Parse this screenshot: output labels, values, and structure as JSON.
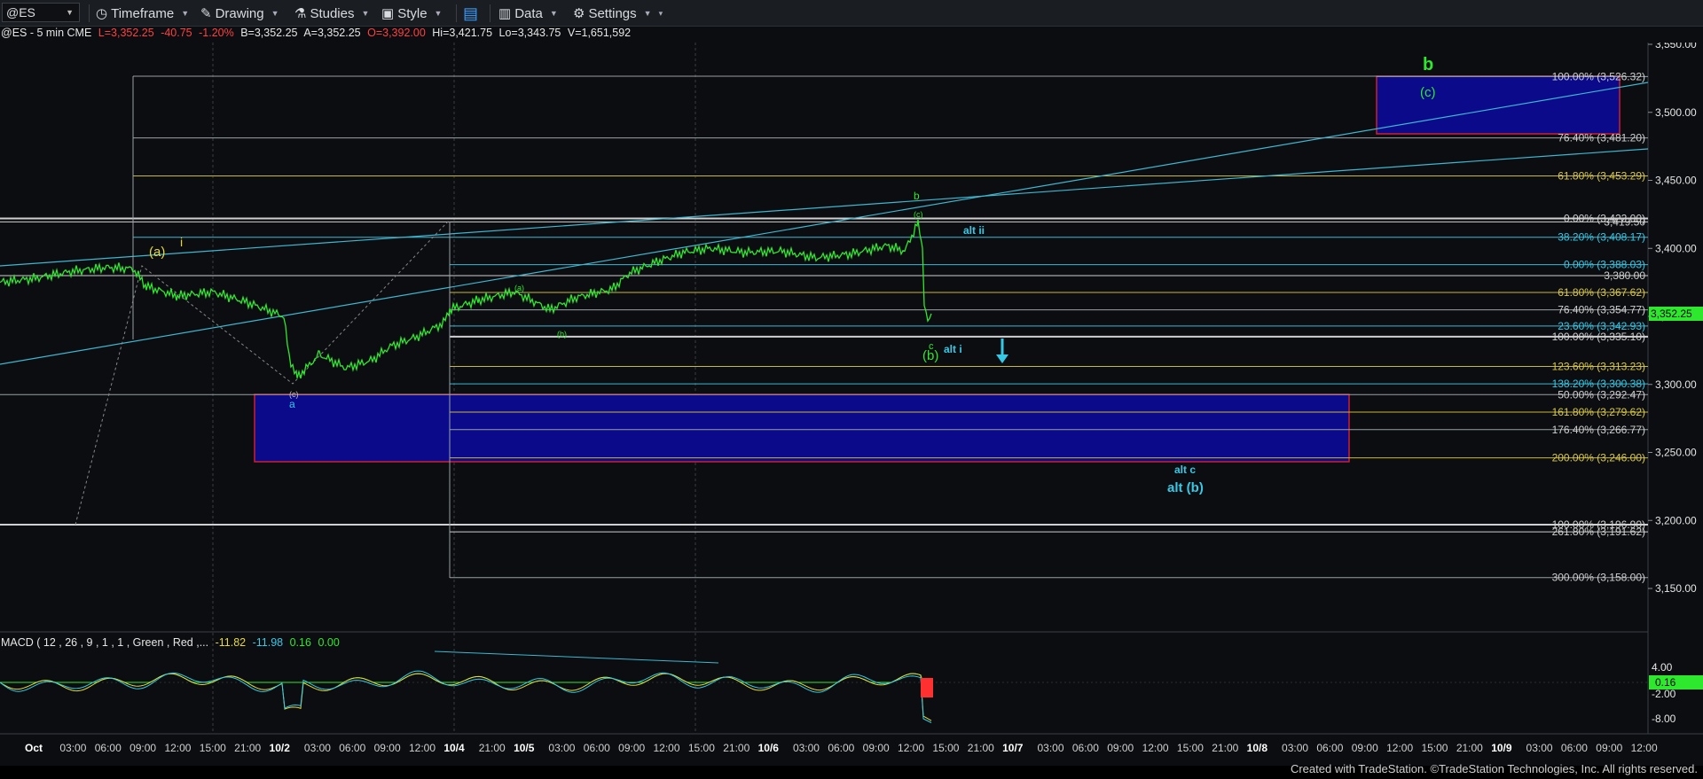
{
  "toolbar": {
    "symbol": "@ES",
    "timeframe": "Timeframe",
    "drawing": "Drawing",
    "studies": "Studies",
    "style": "Style",
    "data": "Data",
    "settings": "Settings"
  },
  "info": {
    "symbol": "@ES - 5 min CME",
    "last": "L=3,352.25",
    "change": "-40.75",
    "pct": "-1.20%",
    "bid": "B=3,352.25",
    "ask": "A=3,352.25",
    "open": "O=3,392.00",
    "high": "Hi=3,421.75",
    "low": "Lo=3,343.75",
    "volume": "V=1,651,592"
  },
  "colors": {
    "background": "#0b0d10",
    "price": "#2ee82e",
    "down": "#ff3030",
    "up": "#2ee82e",
    "wave_cyan": "#35c9e6",
    "wave_yellow": "#e8d83a",
    "box_fill": "#0a0a8a",
    "box_border": "#cc2030"
  },
  "price_axis": {
    "ticks": [
      "3,550.00",
      "3,500.00",
      "3,450.00",
      "3,400.00",
      "3,350.00",
      "3,300.00",
      "3,250.00",
      "3,200.00",
      "3,150.00"
    ],
    "last_price": "3,352.25"
  },
  "fib_labels": [
    "100.00% (3,526.32)",
    "76.40% (3,481.20)",
    "61.80% (3,453.29)",
    "0.00% (3,422.00)",
    "3,419.50",
    "38.20% (3,408.17)",
    "0.00% (3,388.03)",
    "3,380.00",
    "61.80% (3,367.62)",
    "76.40% (3,354.77)",
    "23.60% (3,342.93)",
    "100.00% (3,335.10)",
    "123.60% (3,313.23)",
    "138.20% (3,300.38)",
    "50.00% (3,292.47)",
    "161.80% (3,279.62)",
    "176.40% (3,266.77)",
    "200.00% (3,246.00)",
    "100.00% (3,196.90)",
    "261.80% (3,191.62)",
    "300.00% (3,158.00)"
  ],
  "wave_labels": {
    "b_big": "b",
    "c_big": "(c)",
    "b_small": "b",
    "c_circle": "(c)",
    "alt_ii": "alt ii",
    "c_small": "c",
    "b_paren": "(b)",
    "alt_i": "alt i",
    "alt_c": "alt c",
    "alt_b": "alt (b)",
    "a_paren": "(a)",
    "i_yellow": "i",
    "a_green": "a",
    "a_circle": "(a)",
    "b_circle": "(b)",
    "c_circle2": "(c)"
  },
  "macd": {
    "label": "MACD ( 12 , 26 , 9 , 1 , 1 , Green , Red ,...",
    "v1": "-11.82",
    "v2": "-11.98",
    "v3": "0.16",
    "v4": "0.00",
    "ticks": [
      "4.00",
      "-2.00",
      "-8.00"
    ],
    "current": "0.16"
  },
  "time_axis": [
    "Oct",
    "03:00",
    "06:00",
    "09:00",
    "12:00",
    "15:00",
    "21:00",
    "10/2",
    "03:00",
    "06:00",
    "09:00",
    "12:00",
    "10/4",
    "21:00",
    "10/5",
    "03:00",
    "06:00",
    "09:00",
    "12:00",
    "15:00",
    "21:00",
    "10/6",
    "03:00",
    "06:00",
    "09:00",
    "12:00",
    "15:00",
    "21:00",
    "10/7",
    "03:00",
    "06:00",
    "09:00",
    "12:00",
    "15:00",
    "21:00",
    "10/8",
    "03:00",
    "06:00",
    "09:00",
    "12:00",
    "15:00",
    "21:00",
    "10/9",
    "03:00",
    "06:00",
    "09:00",
    "12:00"
  ],
  "footer": "Created with TradeStation. ©TradeStation Technologies, Inc. All rights reserved."
}
